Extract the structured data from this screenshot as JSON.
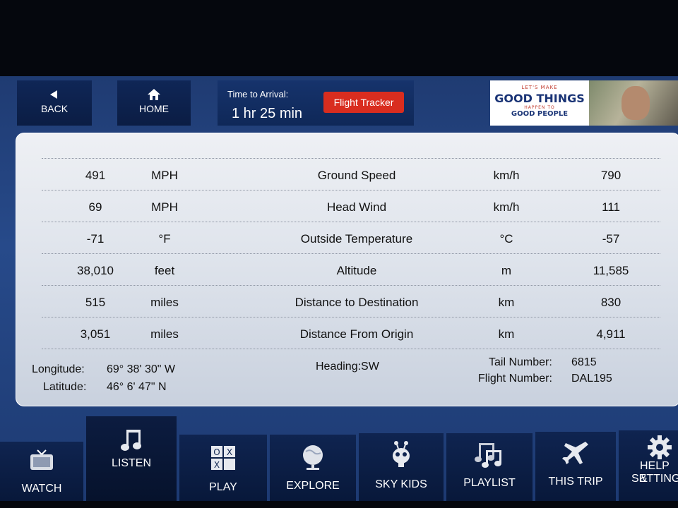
{
  "topbar": {
    "back_label": "BACK",
    "home_label": "HOME",
    "arrival_caption": "Time to Arrival:",
    "arrival_value": "1 hr 25 min",
    "tracker_label": "Flight Tracker",
    "ad": {
      "line1": "LET'S MAKE",
      "line2": "GOOD THINGS",
      "line3": "HAPPEN TO",
      "line4": "GOOD PEOPLE"
    }
  },
  "stats": [
    {
      "imperial": "491",
      "imperial_unit": "MPH",
      "label": "Ground Speed",
      "metric_unit": "km/h",
      "metric": "790"
    },
    {
      "imperial": "69",
      "imperial_unit": "MPH",
      "label": "Head Wind",
      "metric_unit": "km/h",
      "metric": "111"
    },
    {
      "imperial": "-71",
      "imperial_unit": "°F",
      "label": "Outside Temperature",
      "metric_unit": "°C",
      "metric": "-57"
    },
    {
      "imperial": "38,010",
      "imperial_unit": "feet",
      "label": "Altitude",
      "metric_unit": "m",
      "metric": "11,585"
    },
    {
      "imperial": "515",
      "imperial_unit": "miles",
      "label": "Distance to Destination",
      "metric_unit": "km",
      "metric": "830"
    },
    {
      "imperial": "3,051",
      "imperial_unit": "miles",
      "label": "Distance From Origin",
      "metric_unit": "km",
      "metric": "4,911"
    }
  ],
  "position": {
    "longitude_label": "Longitude:",
    "longitude": "69° 38' 30\" W",
    "latitude_label": "Latitude:",
    "latitude": "46° 6' 47\" N",
    "heading": "Heading:SW",
    "tail_label": "Tail Number:",
    "tail": "6815",
    "flight_label": "Flight Number:",
    "flight": "DAL195"
  },
  "tabs": [
    {
      "label": "WATCH",
      "icon": "tv-icon"
    },
    {
      "label": "LISTEN",
      "icon": "music-note-icon",
      "active": true
    },
    {
      "label": "PLAY",
      "icon": "tic-tac-toe-icon"
    },
    {
      "label": "EXPLORE",
      "icon": "globe-icon"
    },
    {
      "label": "SKY KIDS",
      "icon": "alien-icon"
    },
    {
      "label": "PLAYLIST",
      "icon": "playlist-icon"
    },
    {
      "label": "THIS TRIP",
      "icon": "airplane-icon"
    },
    {
      "label": "HELP &",
      "label2": "SETTING",
      "icon": "gear-icon"
    }
  ],
  "colors": {
    "tracker_button": "#d92d1f",
    "bar_blue": "#0f2656",
    "panel": "#e4e8ef"
  }
}
